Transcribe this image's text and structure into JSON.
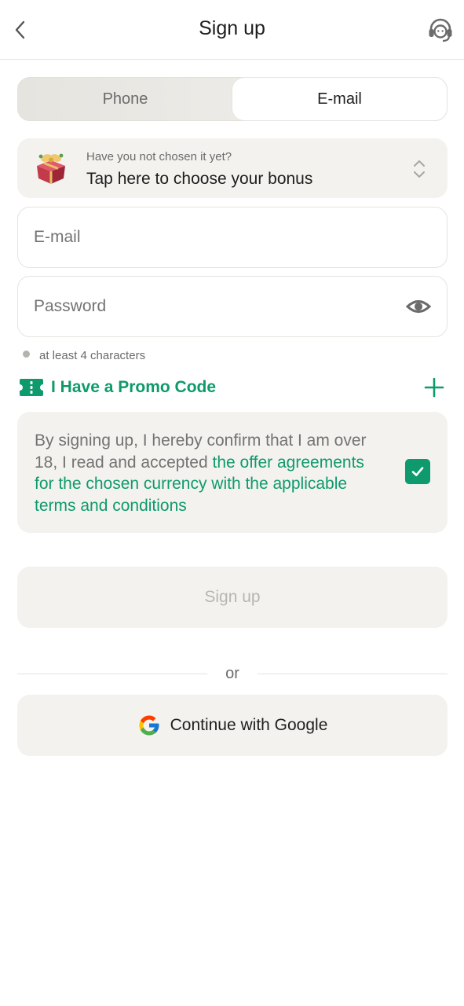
{
  "header": {
    "title": "Sign up",
    "back_icon": "chevron-left-icon",
    "support_icon": "headset-icon"
  },
  "tabs": [
    {
      "label": "Phone",
      "selected": false
    },
    {
      "label": "E-mail",
      "selected": true
    }
  ],
  "bonus": {
    "hint": "Have you not chosen it yet?",
    "title": "Tap here to choose your bonus",
    "icon": "gift-box-icon",
    "chevron_icon": "chevron-up-down-icon"
  },
  "form": {
    "email_placeholder": "E-mail",
    "email_value": "",
    "password_placeholder": "Password",
    "password_value": "",
    "password_hint": "at least 4 characters"
  },
  "promo": {
    "label": "I Have a Promo Code",
    "icon": "ticket-icon",
    "add_icon": "plus-icon"
  },
  "terms": {
    "text_plain": "By signing up, I hereby confirm that I am over 18, I read and accepted ",
    "text_link": "the offer agreements for the chosen currency with the applicable terms and conditions",
    "checked": true
  },
  "buttons": {
    "signup_label": "Sign up",
    "divider_label": "or",
    "google_label": "Continue with Google"
  },
  "colors": {
    "accent": "#0e9a6c",
    "surface": "#f3f2ef",
    "disabled_text": "#b8b6b1"
  }
}
